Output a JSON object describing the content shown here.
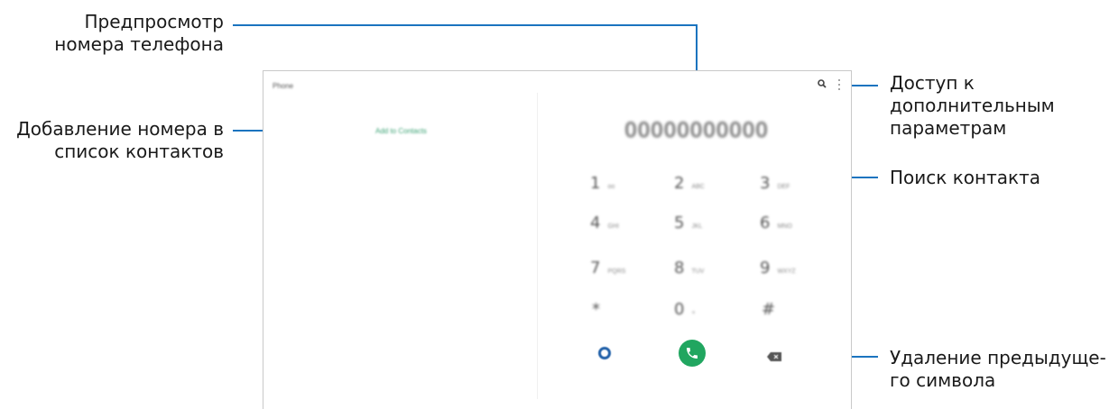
{
  "callouts": {
    "preview": [
      "Предпросмотр",
      "номера телефона"
    ],
    "add_contact": [
      "Добавление номера в",
      "список контактов"
    ],
    "more_options": [
      "Доступ к",
      "дополнительным",
      "параметрам"
    ],
    "search": [
      "Поиск контакта"
    ],
    "delete": [
      "Удаление предыдуще-",
      "го символа"
    ]
  },
  "screen": {
    "app_title": "Phone",
    "add_contact_link": "Add to Contacts",
    "number": "00000000000",
    "keys": [
      {
        "digit": "1",
        "letters": "oo"
      },
      {
        "digit": "2",
        "letters": "ABC"
      },
      {
        "digit": "3",
        "letters": "DEF"
      },
      {
        "digit": "4",
        "letters": "GHI"
      },
      {
        "digit": "5",
        "letters": "JKL"
      },
      {
        "digit": "6",
        "letters": "MNO"
      },
      {
        "digit": "7",
        "letters": "PQRS"
      },
      {
        "digit": "8",
        "letters": "TUV"
      },
      {
        "digit": "9",
        "letters": "WXYZ"
      },
      {
        "digit": "*",
        "letters": ""
      },
      {
        "digit": "0",
        "letters": "+"
      },
      {
        "digit": "#",
        "letters": ""
      }
    ]
  },
  "colors": {
    "callout_line": "#1b74bf",
    "call_button": "#21a660",
    "accent_green": "#3ba274"
  }
}
